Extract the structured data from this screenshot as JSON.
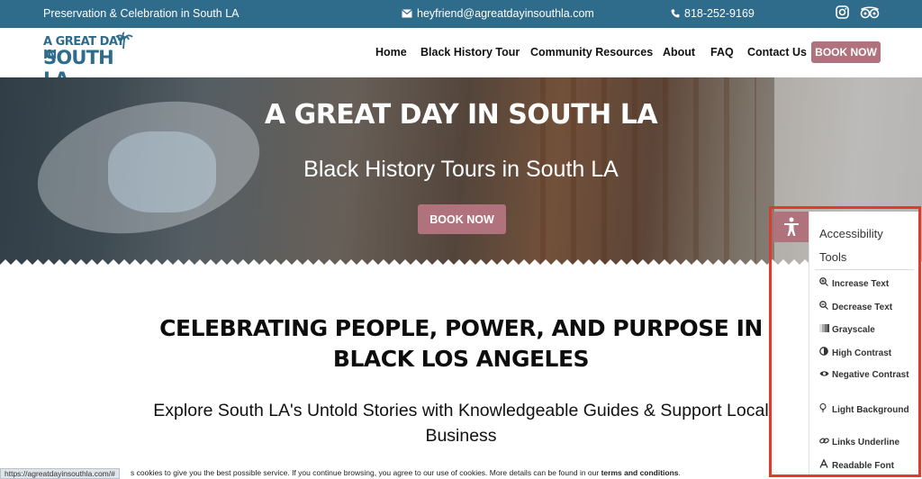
{
  "topbar": {
    "tagline": "Preservation & Celebration in South LA",
    "email": "heyfriend@agreatdayinsouthla.com",
    "phone": "818-252-9169",
    "icons": [
      "email-icon",
      "phone-icon",
      "instagram-icon",
      "tripadvisor-icon"
    ]
  },
  "header": {
    "logo_line1": "A GREAT DAY IN",
    "logo_line2": "SOUTH LA",
    "nav": [
      "Home",
      "Black History Tour",
      "Community Resources",
      "About",
      "FAQ",
      "Contact Us"
    ],
    "book_now": "BOOK NOW"
  },
  "hero": {
    "title": "A GREAT DAY IN SOUTH LA",
    "subtitle": "Black History Tours in South LA",
    "button": "BOOK NOW"
  },
  "content": {
    "heading": "CELEBRATING PEOPLE, POWER, AND PURPOSE IN BLACK LOS ANGELES",
    "subheading": "Explore South LA's Untold Stories with Knowledgeable Guides & Support Local Business"
  },
  "cookie": {
    "text": "s cookies to give you the best possible service. If you continue browsing, you agree to our use of cookies. More details can be found in our ",
    "link": "terms and conditions",
    "end": "."
  },
  "status_url": "https://agreatdayinsouthla.com/#",
  "accessibility": {
    "title": "Accessibility Tools",
    "items": [
      {
        "label": "Increase Text",
        "icon": "zoom-in-icon"
      },
      {
        "label": "Decrease Text",
        "icon": "zoom-out-icon"
      },
      {
        "label": "Grayscale",
        "icon": "grayscale-icon"
      },
      {
        "label": "High Contrast",
        "icon": "contrast-icon"
      },
      {
        "label": "Negative Contrast",
        "icon": "eye-icon"
      },
      {
        "label": "Light Background",
        "icon": "lightbulb-icon"
      },
      {
        "label": "Links Underline",
        "icon": "link-icon"
      },
      {
        "label": "Readable Font",
        "icon": "font-icon"
      }
    ]
  },
  "colors": {
    "topbar": "#2f6b8a",
    "accent": "#b0737d",
    "highlight": "#e0392e"
  }
}
